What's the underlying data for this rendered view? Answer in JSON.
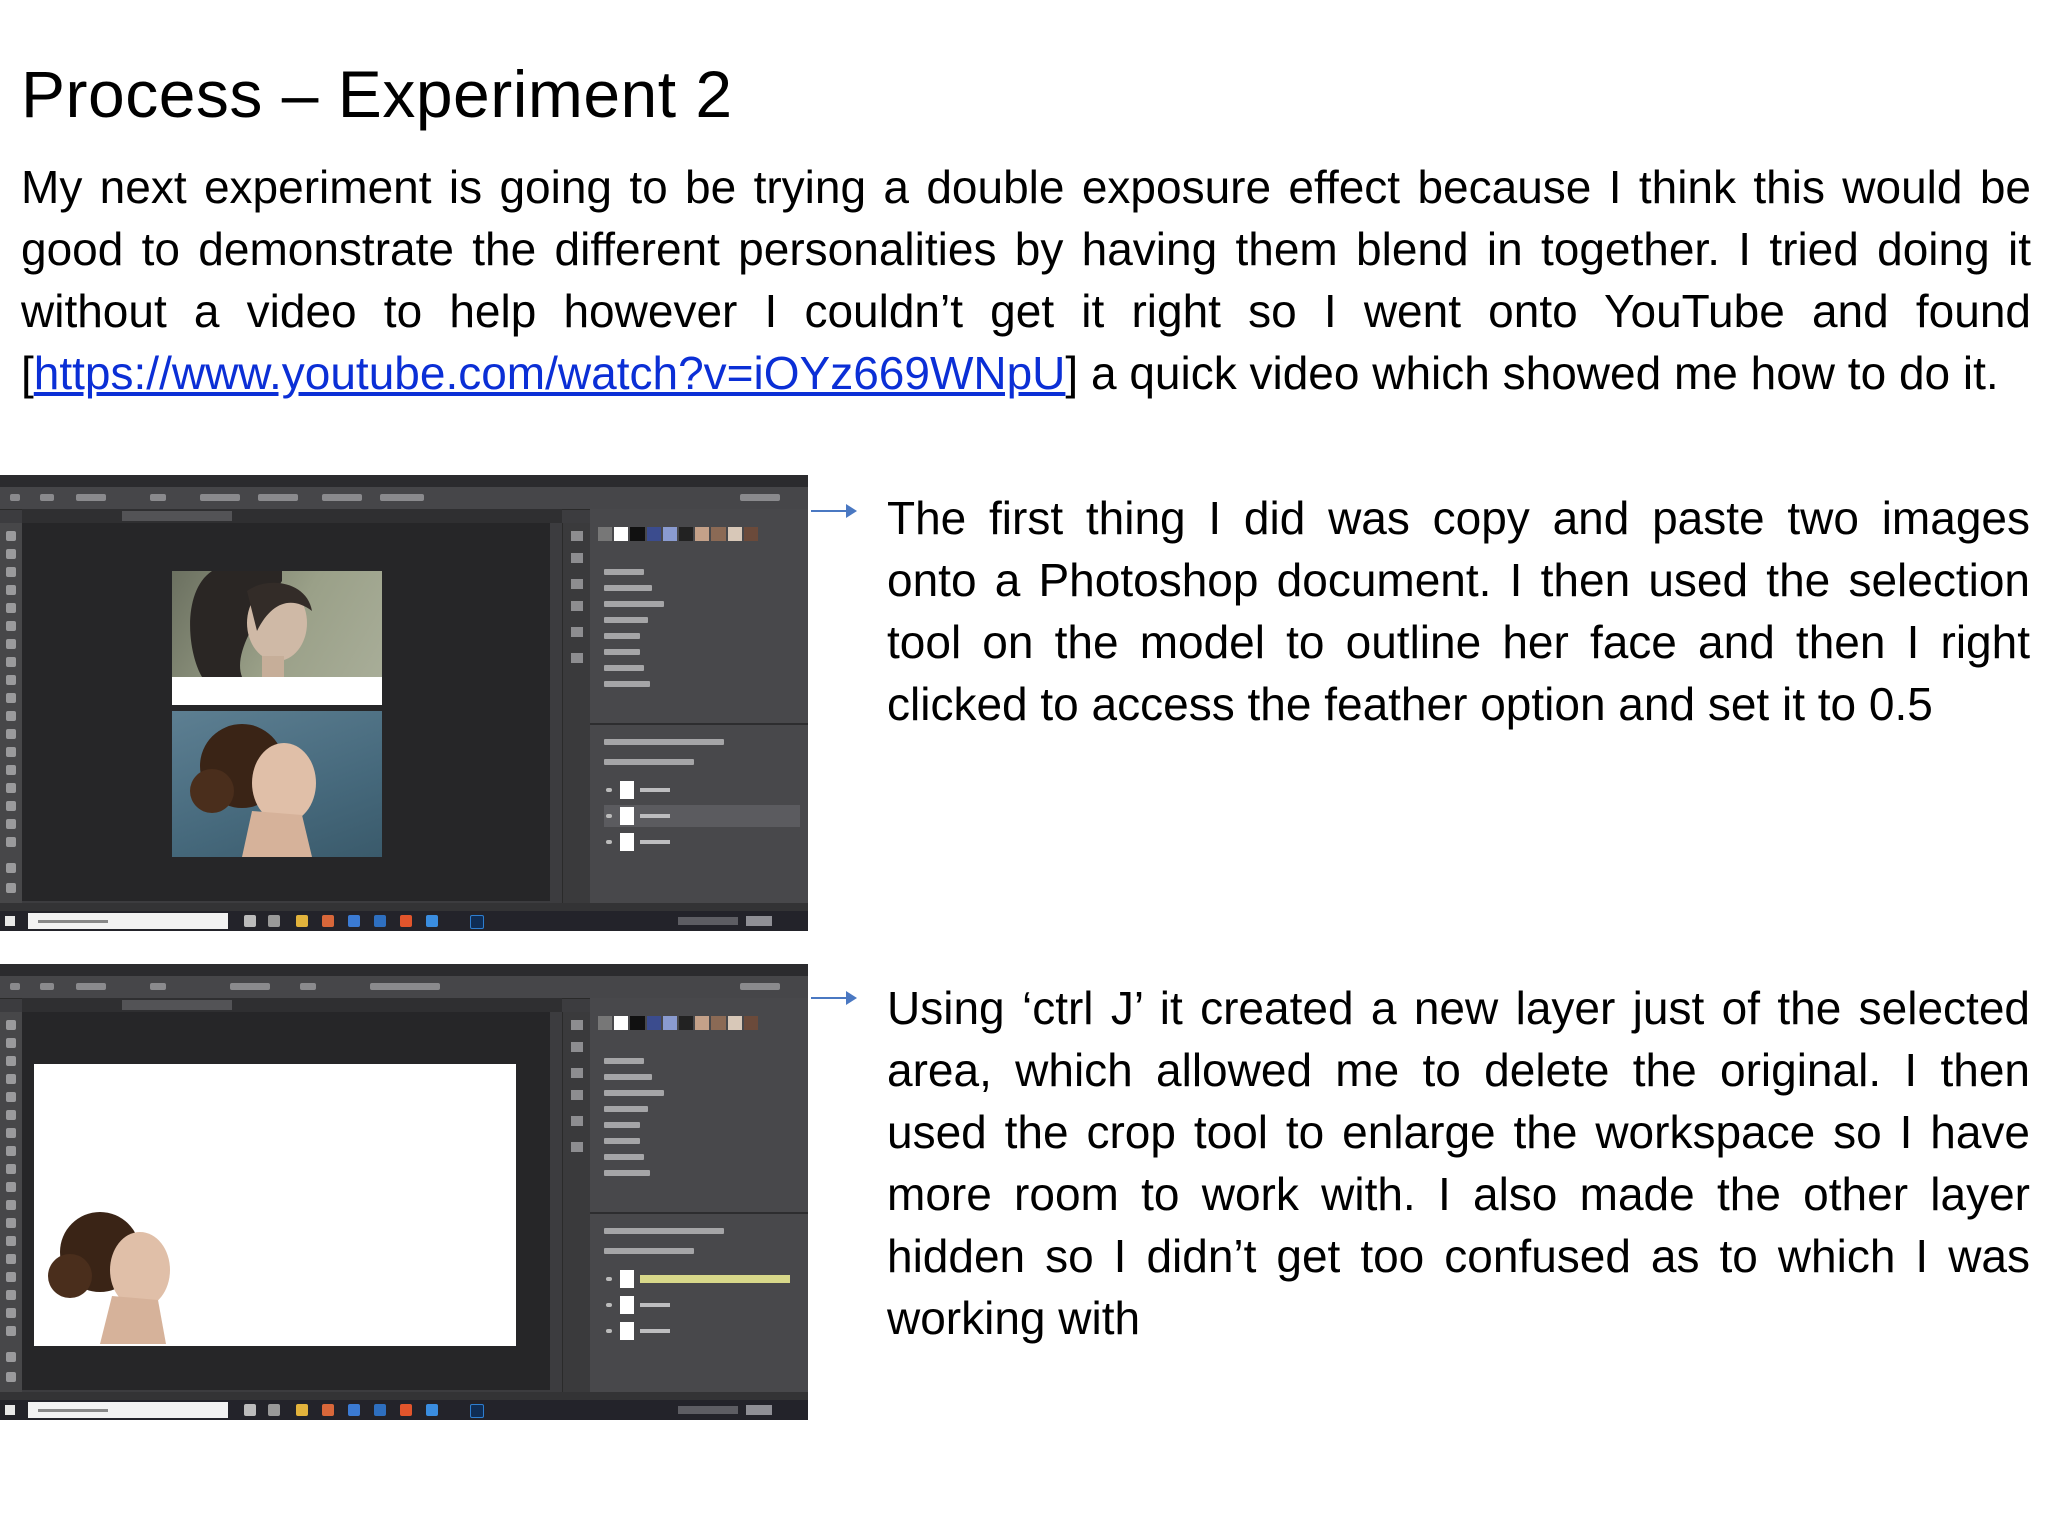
{
  "title": "Process – Experiment 2",
  "intro": {
    "before_link": "My next experiment is going to be trying a double exposure effect because I think this would be good to demonstrate the different personalities by having them blend in together. I tried doing it without a video to help however I couldn’t get it right so I went onto YouTube and found [",
    "link_text": "https://www.youtube.com/watch?v=iOYz669WNpU",
    "after_link": "] a quick video which showed me how to do it."
  },
  "steps": [
    {
      "screenshot_icon": "photoshop-screenshot-two-portraits",
      "description": "The first thing I did was copy and paste two images onto a Photoshop document. I then used the selection tool on the model to outline her face and then I right clicked to access the feather option and set it to 0.5"
    },
    {
      "screenshot_icon": "photoshop-screenshot-enlarged-canvas",
      "description": "Using ‘ctrl J’ it created a new layer just of the selected area, which allowed me to delete the original. I then used the crop tool to enlarge the workspace so I have more room to work with. I also made the other layer hidden so I didn’t get too confused as to which I was working with"
    }
  ],
  "colors": {
    "link": "#0b2fd6",
    "arrow": "#4a78c2",
    "photoshop_panel": "#48484b",
    "photoshop_workspace": "#262628"
  }
}
